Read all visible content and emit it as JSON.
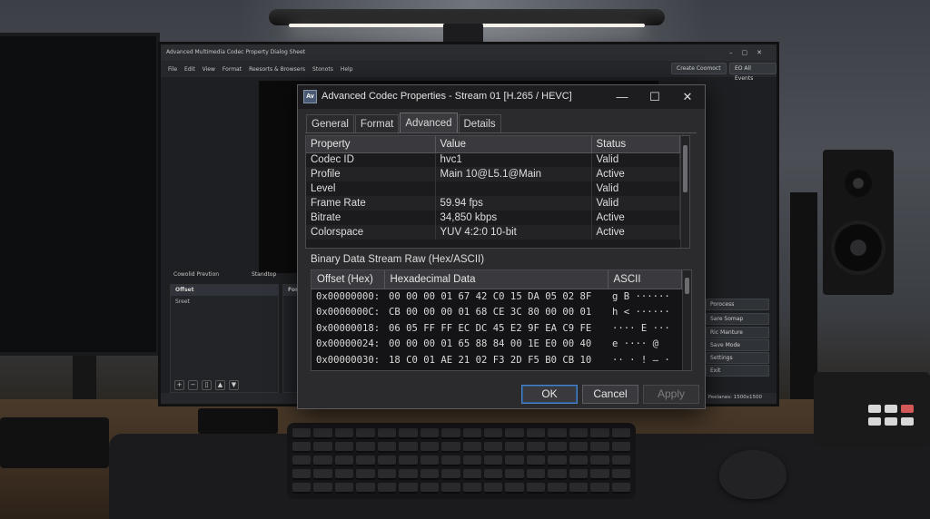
{
  "app": {
    "title": "Advanced Multimedia Codec Property Dialog Sheet",
    "menu": [
      "File",
      "Edit",
      "View",
      "Format",
      "Reesorts & Browsers",
      "Stonots",
      "Help"
    ],
    "top_buttons": [
      "Create Coomoct",
      "EO All Events"
    ],
    "preview_label": "Cowolid Prevtion",
    "standby_label": "Standtop",
    "dock_left": {
      "header": "Offset",
      "row": "Sreet"
    },
    "dock_mid": {
      "header": "Fors"
    },
    "side_controls": [
      "Porocess",
      "Sare Somap",
      "Ric Manture",
      "Save Mode",
      "Settings",
      "Exit"
    ],
    "status_text": "Peelanes: 1500x1500"
  },
  "dialog": {
    "title": "Advanced Codec Properties - Stream 01 [H.265 / HEVC]",
    "tabs": [
      "General",
      "Format",
      "Advanced",
      "Details"
    ],
    "active_tab": "Advanced",
    "property_table": {
      "headers": [
        "Property",
        "Value",
        "Status"
      ],
      "rows": [
        {
          "property": "Codec ID",
          "value": "hvc1",
          "status": "Valid"
        },
        {
          "property": "Profile",
          "value": "Main 10@L5.1@Main",
          "status": "Active"
        },
        {
          "property": "Level",
          "value": "",
          "status": "Valid"
        },
        {
          "property": "Frame Rate",
          "value": "59.94 fps",
          "status": "Valid"
        },
        {
          "property": "Bitrate",
          "value": "34,850 kbps",
          "status": "Active"
        },
        {
          "property": "Colorspace",
          "value": "YUV 4:2:0 10-bit",
          "status": "Active"
        }
      ]
    },
    "stream_label": "Binary Data Stream Raw (Hex/ASCII)",
    "hex_table": {
      "headers": [
        "Offset (Hex)",
        "Hexadecimal Data",
        "ASCII"
      ],
      "rows": [
        {
          "offset": "0x00000000:",
          "hex": "00 00 00 01 67 42 C0 15 DA 05 02 8F",
          "ascii": "g B ······"
        },
        {
          "offset": "0x0000000C:",
          "hex": "CB 00 00 00 01 68 CE 3C 80 00 00 01",
          "ascii": "h < ······"
        },
        {
          "offset": "0x00000018:",
          "hex": "06 05 FF FF EC DC 45 E2 9F EA C9 FE",
          "ascii": "···· E ···"
        },
        {
          "offset": "0x00000024:",
          "hex": "00 00 00 01 65 88 84 00 1E E0 00 40",
          "ascii": "e ···· @"
        },
        {
          "offset": "0x00000030:",
          "hex": "18 C0 01 AE 21 02 F3 2D F5 B0 CB 10",
          "ascii": "·· · ! – ·"
        }
      ]
    },
    "buttons": {
      "ok": "OK",
      "cancel": "Cancel",
      "apply": "Apply"
    }
  },
  "colors": {
    "dialog_bg": "#2b2b2d",
    "titlebar": "#1d1d1f",
    "accent_focus": "#4e83c4",
    "text": "#e2e2e2"
  }
}
